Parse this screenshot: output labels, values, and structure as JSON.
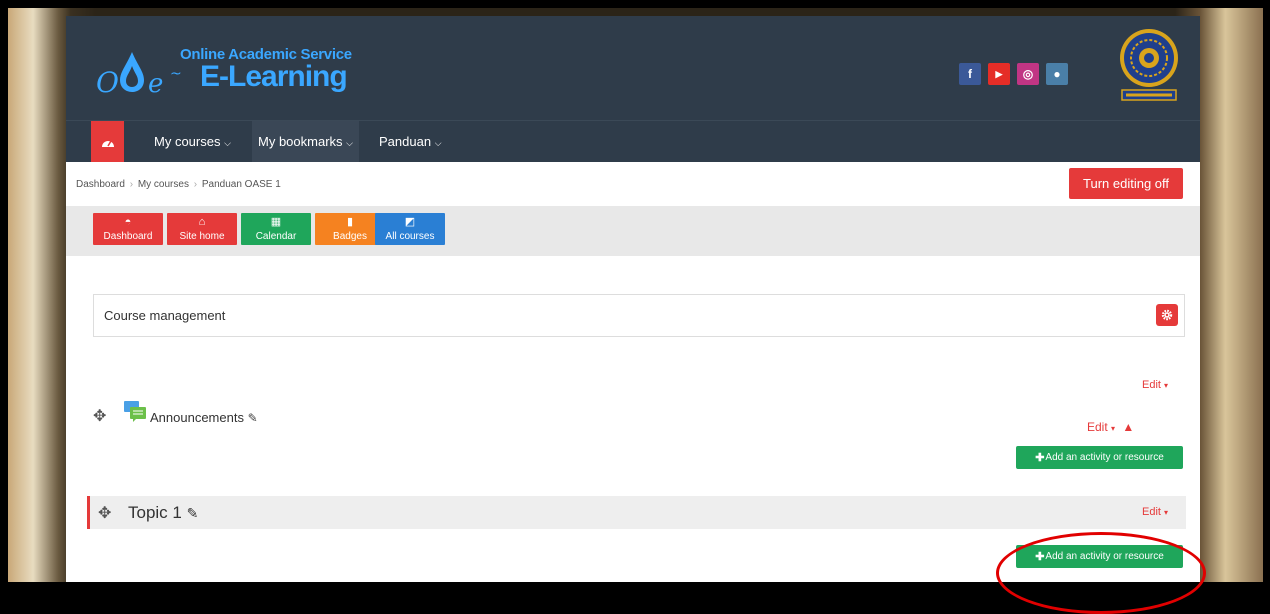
{
  "header": {
    "logo_line1": "Online Academic Service",
    "logo_line2": "E-Learning",
    "socials": [
      {
        "icon": "facebook-icon",
        "glyph": "f",
        "color": "#3b5998"
      },
      {
        "icon": "youtube-icon",
        "glyph": "▶",
        "color": "#e52d27"
      },
      {
        "icon": "instagram-icon",
        "glyph": "◎",
        "color": "#c13584"
      },
      {
        "icon": "globe-icon",
        "glyph": "●",
        "color": "#4a7fa8"
      }
    ]
  },
  "nav": {
    "home_icon": "dashboard-icon",
    "items": [
      "My courses",
      "My bookmarks",
      "Panduan"
    ]
  },
  "breadcrumb": {
    "items": [
      "Dashboard",
      "My courses",
      "Panduan OASE 1"
    ]
  },
  "turn_editing_label": "Turn editing off",
  "quick_buttons": [
    {
      "label": "Dashboard",
      "icon": "dashboard-icon",
      "color": "#e53a3a"
    },
    {
      "label": "Site home",
      "icon": "home-icon",
      "color": "#e53a3a"
    },
    {
      "label": "Calendar",
      "icon": "calendar-icon",
      "color": "#1fa65b"
    },
    {
      "label": "Badges",
      "icon": "bookmark-icon",
      "color": "#f58220"
    },
    {
      "label": "All courses",
      "icon": "book-icon",
      "color": "#2a7fd4"
    }
  ],
  "course_management": {
    "title": "Course management"
  },
  "section0": {
    "edit_label": "Edit",
    "activity_name": "Announcements",
    "activity_edit_label": "Edit",
    "add_label": "Add an activity or resource"
  },
  "topic1": {
    "title": "Topic 1",
    "edit_label": "Edit",
    "add_label": "Add an activity or resource"
  },
  "colors": {
    "brand_red": "#e53a3a",
    "navbar": "#2f3c4a",
    "add_green": "#1fa65b",
    "annotation_red": "#e10000"
  }
}
